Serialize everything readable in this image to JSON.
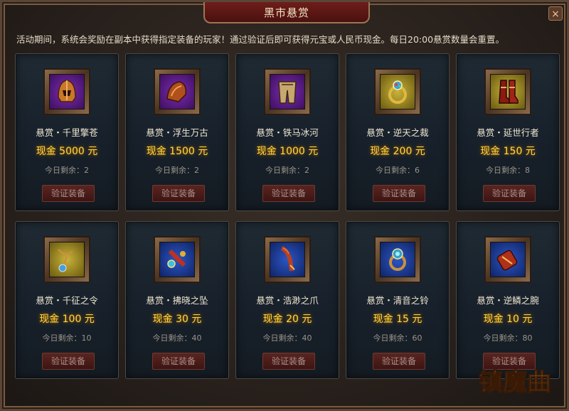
{
  "window": {
    "title": "黑市悬赏",
    "close_label": "×"
  },
  "intro": "活动期间，系统会奖励在副本中获得指定装备的玩家！通过验证后即可获得元宝或人民币现金。每日20:00悬赏数量会重置。",
  "cards": [
    {
      "name": "悬赏・千里擎苍",
      "reward": "现金 5000 元",
      "remain": "今日剩余：2",
      "button": "验证装备",
      "icon": "helmet-icon",
      "bg": "purple"
    },
    {
      "name": "悬赏・浮生万古",
      "reward": "现金 1500 元",
      "remain": "今日剩余：2",
      "button": "验证装备",
      "icon": "shoulder-armor-icon",
      "bg": "purple"
    },
    {
      "name": "悬赏・铁马冰河",
      "reward": "现金 1000 元",
      "remain": "今日剩余：2",
      "button": "验证装备",
      "icon": "leg-armor-icon",
      "bg": "purple"
    },
    {
      "name": "悬赏・逆天之裁",
      "reward": "现金 200 元",
      "remain": "今日剩余：6",
      "button": "验证装备",
      "icon": "ring-icon",
      "bg": "yellow"
    },
    {
      "name": "悬赏・延世行者",
      "reward": "现金 150 元",
      "remain": "今日剩余：8",
      "button": "验证装备",
      "icon": "boots-icon",
      "bg": "yellow"
    },
    {
      "name": "悬赏・千征之令",
      "reward": "现金 100 元",
      "remain": "今日剩余：10",
      "button": "验证装备",
      "icon": "amulet-icon",
      "bg": "yellow"
    },
    {
      "name": "悬赏・拂晓之坠",
      "reward": "现金 30 元",
      "remain": "今日剩余：40",
      "button": "验证装备",
      "icon": "pendant-icon",
      "bg": "blue"
    },
    {
      "name": "悬赏・浩渺之爪",
      "reward": "现金 20 元",
      "remain": "今日剩余：40",
      "button": "验证装备",
      "icon": "claw-icon",
      "bg": "blue"
    },
    {
      "name": "悬赏・清音之铃",
      "reward": "现金 15 元",
      "remain": "今日剩余：60",
      "button": "验证装备",
      "icon": "bell-ring-icon",
      "bg": "blue"
    },
    {
      "name": "悬赏・逆鳞之腕",
      "reward": "现金 10 元",
      "remain": "今日剩余：80",
      "button": "验证装备",
      "icon": "bracer-icon",
      "bg": "blue"
    }
  ],
  "logo": {
    "text": "镇魔曲",
    "icon": "game-logo"
  },
  "colors": {
    "reward_gold": "#ffd54a",
    "title_red": "#6e1d1a",
    "frame_bronze": "#8a6a4a",
    "bg_purple": "#7d2cb0",
    "bg_yellow": "#c9b33a",
    "bg_blue": "#2c56c4"
  }
}
